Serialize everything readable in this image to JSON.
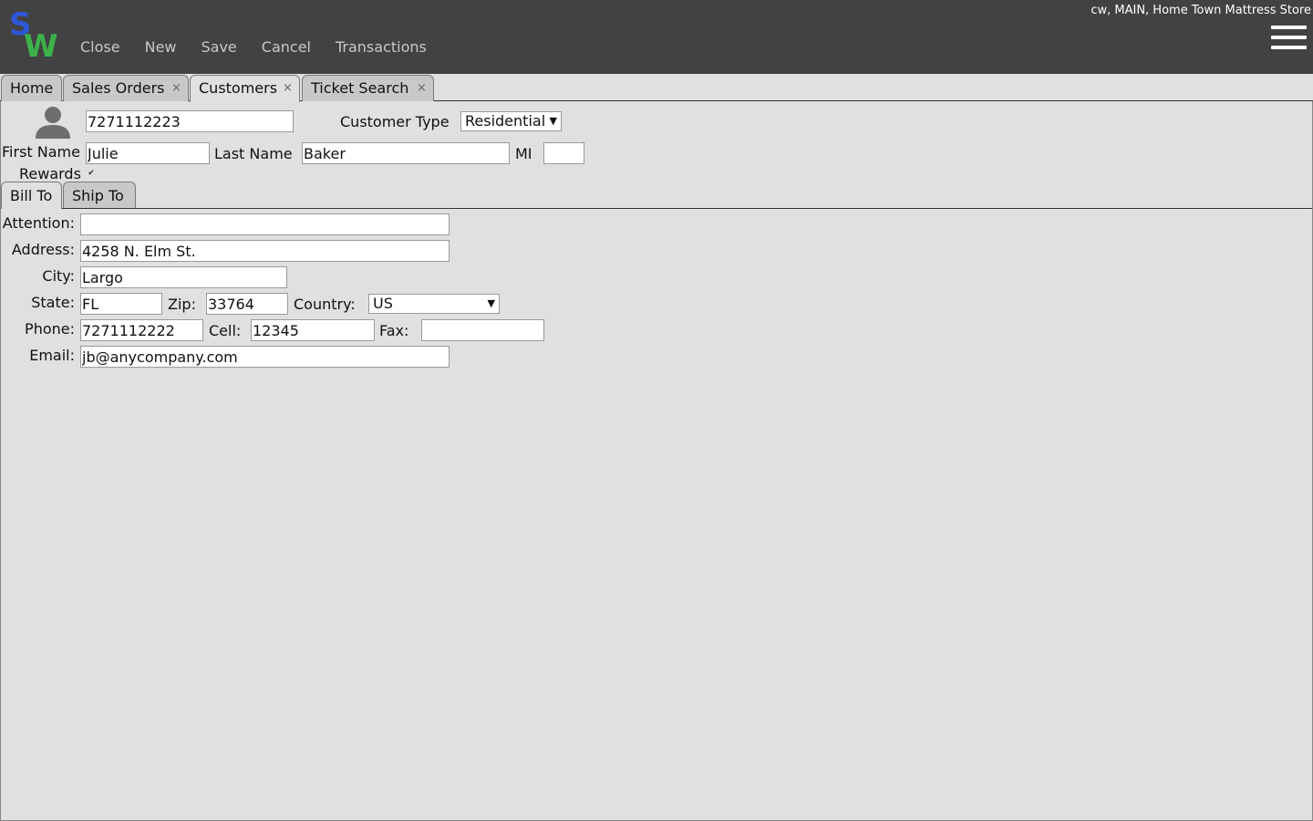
{
  "header": {
    "logo_letter_1": "S",
    "logo_letter_2": "W",
    "menu": [
      "Close",
      "New",
      "Save",
      "Cancel",
      "Transactions"
    ],
    "user_info": "cw, MAIN, Home Town Mattress Store",
    "menu_icon": "hamburger-icon"
  },
  "tabs": [
    {
      "label": "Home",
      "closable": false
    },
    {
      "label": "Sales Orders",
      "closable": true
    },
    {
      "label": "Customers",
      "closable": true,
      "active": true
    },
    {
      "label": "Ticket Search",
      "closable": true
    }
  ],
  "close_glyph": "×",
  "customer": {
    "icon": "person-icon",
    "number": "7271112223",
    "customer_type_label": "Customer Type",
    "customer_type": "Residential",
    "first_name_label": "First Name",
    "first_name": "Julie",
    "last_name_label": "Last Name",
    "last_name": "Baker",
    "mi_label": "MI",
    "mi": "",
    "rewards_label": "Rewards",
    "rewards_checked": true,
    "rewards_glyph": "✔"
  },
  "subtabs": [
    {
      "label": "Bill To",
      "active": true
    },
    {
      "label": "Ship To"
    }
  ],
  "bill_to": {
    "attention_label": "Attention:",
    "attention": "",
    "address_label": "Address:",
    "address": "4258 N. Elm St.",
    "city_label": "City:",
    "city": "Largo",
    "state_label": "State:",
    "state": "FL",
    "zip_label": "Zip:",
    "zip": "33764",
    "country_label": "Country:",
    "country": "US",
    "phone_label": "Phone:",
    "phone": "7271112222",
    "cell_label": "Cell:",
    "cell": "12345",
    "fax_label": "Fax:",
    "fax": "",
    "email_label": "Email:",
    "email": "jb@anycompany.com"
  },
  "dropdown_arrow": "▼"
}
